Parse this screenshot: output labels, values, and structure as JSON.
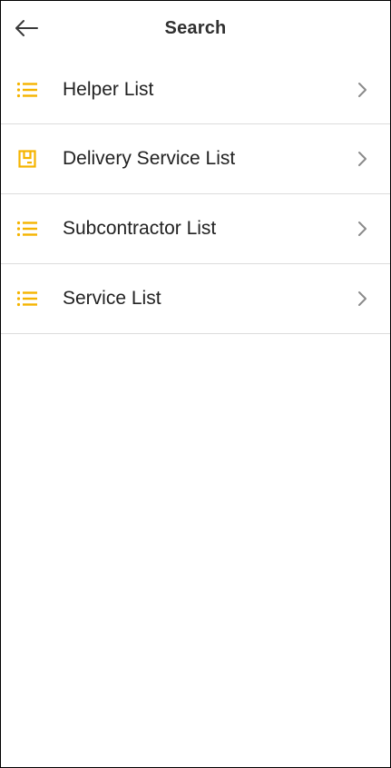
{
  "header": {
    "title": "Search"
  },
  "list": {
    "items": [
      {
        "label": "Helper List",
        "icon": "list-icon"
      },
      {
        "label": "Delivery Service List",
        "icon": "delivery-box-icon"
      },
      {
        "label": "Subcontractor List",
        "icon": "list-icon"
      },
      {
        "label": "Service List",
        "icon": "list-icon"
      }
    ]
  },
  "colors": {
    "accent": "#F5B400",
    "divider": "#DCDCDC",
    "text": "#222222",
    "chevron": "#8A8A8A"
  }
}
